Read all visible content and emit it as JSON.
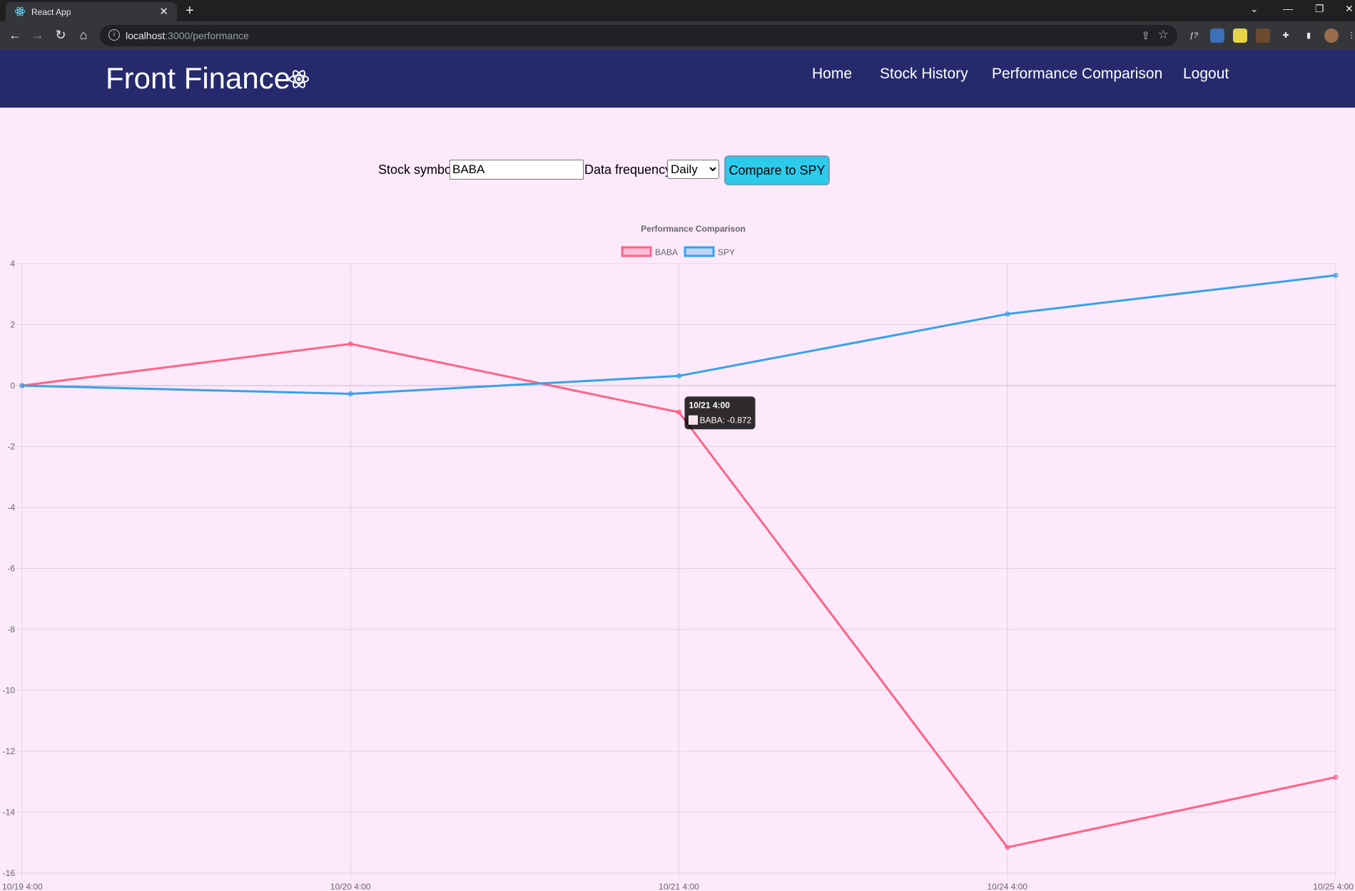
{
  "browser": {
    "tab_title": "React App",
    "tab_close_icon": "close-icon",
    "new_tab_icon": "plus-icon",
    "url_host": "localhost",
    "url_path": ":3000/performance"
  },
  "header": {
    "brand": "Front Finance",
    "brand_icon": "react-atom-icon",
    "nav": [
      "Home",
      "Stock History",
      "Performance Comparison",
      "Logout"
    ]
  },
  "form": {
    "symbol_label": "Stock symbol:",
    "symbol_value": "BABA",
    "frequency_label": "Data frequency:",
    "frequency_selected": "Daily",
    "compare_button": "Compare to SPY"
  },
  "chart_data": {
    "type": "line",
    "title": "Performance Comparison",
    "categories": [
      "10/19 4:00",
      "10/20 4:00",
      "10/21 4:00",
      "10/24 4:00",
      "10/25 4:00"
    ],
    "series": [
      {
        "name": "BABA",
        "color": "#ff6384",
        "values": [
          0,
          1.37,
          -0.872,
          -15.15,
          -12.85
        ]
      },
      {
        "name": "SPY",
        "color": "#36a2eb",
        "values": [
          0,
          -0.27,
          0.32,
          2.35,
          3.62
        ]
      }
    ],
    "ylim": [
      -16,
      4
    ],
    "yticks": [
      4,
      2,
      0,
      -2,
      -4,
      -6,
      -8,
      -10,
      -12,
      -14,
      -16
    ],
    "grid": true,
    "legend_position": "top",
    "tooltip": {
      "title": "10/21 4:00",
      "label": "BABA: -0.872",
      "category_index": 2,
      "series_index": 0
    }
  }
}
